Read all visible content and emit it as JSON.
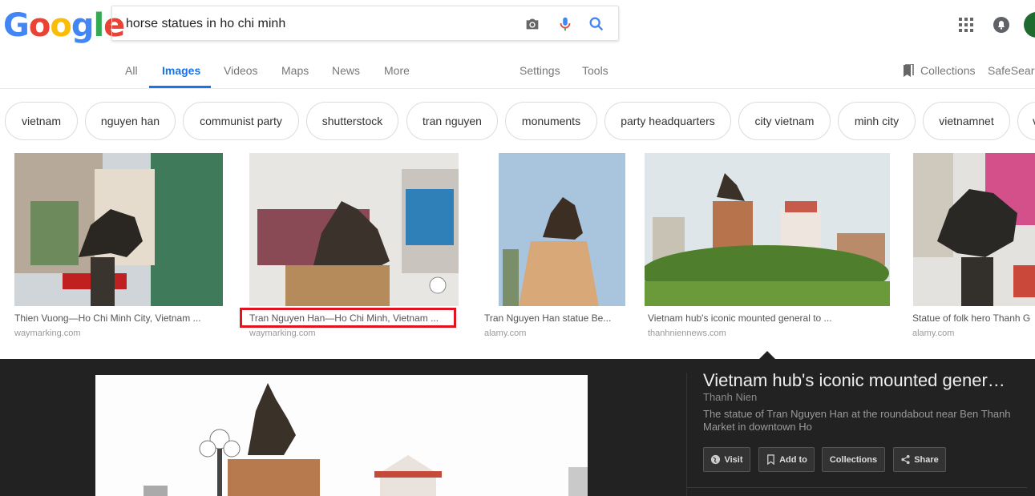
{
  "logo": {
    "letters": [
      "G",
      "o",
      "o",
      "g",
      "l",
      "e"
    ],
    "colors": [
      "#4285f4",
      "#ea4335",
      "#fbbc05",
      "#4285f4",
      "#34a853",
      "#ea4335"
    ]
  },
  "search": {
    "query": "horse statues in ho chi minh"
  },
  "tabs": [
    {
      "label": "All"
    },
    {
      "label": "Images"
    },
    {
      "label": "Videos"
    },
    {
      "label": "Maps"
    },
    {
      "label": "News"
    },
    {
      "label": "More"
    },
    {
      "label": "Settings"
    },
    {
      "label": "Tools"
    },
    {
      "label": "Collections"
    },
    {
      "label": "SafeSearch"
    }
  ],
  "chips": [
    "vietnam",
    "nguyen han",
    "communist party",
    "shutterstock",
    "tran nguyen",
    "monuments",
    "party headquarters",
    "city vietnam",
    "minh city",
    "vietnamnet",
    "v"
  ],
  "results": [
    {
      "caption": "Thien Vuong—Ho Chi Minh City, Vietnam ...",
      "source": "waymarking.com"
    },
    {
      "caption": "Tran Nguyen Han—Ho Chi Minh, Vietnam ...",
      "source": "waymarking.com"
    },
    {
      "caption": "Tran Nguyen Han statue Be...",
      "source": "alamy.com"
    },
    {
      "caption": "Vietnam hub's iconic mounted general to ...",
      "source": "thanhniennews.com"
    },
    {
      "caption": "Statue of folk hero Thanh G",
      "source": "alamy.com"
    }
  ],
  "panel": {
    "title": "Vietnam hub's iconic mounted gener…",
    "site": "Thanh Nien",
    "description": "The statue of Tran Nguyen Han at the roundabout near Ben Thanh Market in downtown Ho",
    "buttons": {
      "visit": "Visit",
      "add_to": "Add to",
      "collections": "Collections",
      "share": "Share"
    }
  },
  "colors": {
    "accent": "#1a73e8",
    "highlight": "#e0141e",
    "panel_bg": "#222222"
  }
}
